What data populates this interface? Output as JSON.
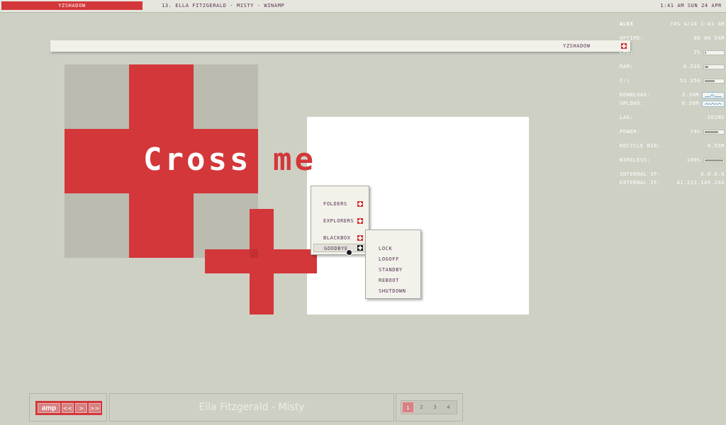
{
  "topbar": {
    "workspace": "YZSHADOW",
    "window_title": "13. ELLA FITZGERALD - MISTY - WINAMP",
    "clock": "1:41 AM SUN 24 APR"
  },
  "slit": {
    "label": "YZSHADOW"
  },
  "wallpaper": {
    "text_white": "Cross",
    "text_red": "me"
  },
  "stats": {
    "user": "ALEX",
    "header_value": "74%  4/24    1:41 AM",
    "rows": [
      {
        "k": "UPTIME:",
        "v": "0D 0H 54M"
      },
      {
        "k": "CPU:",
        "v": "2%",
        "bar": 0.08
      },
      {
        "k": "RAM:",
        "v": "0.52G",
        "bar": 0.2
      },
      {
        "k": "C:\\",
        "v": "51.35G",
        "bar": 0.55
      },
      {
        "k": "DOWNLOAD:",
        "v": "3.34M"
      },
      {
        "k": "UPLOAD:",
        "v": "0.26M"
      },
      {
        "k": "LAG:",
        "v": "261MS"
      },
      {
        "k": "POWER:",
        "v": "74%",
        "bar": 0.74
      },
      {
        "k": "RECYCLE BIN:",
        "v": "0.55M"
      },
      {
        "k": "WIRELESS:",
        "v": "100%",
        "bar": 1.0
      },
      {
        "k": "INTERNAL IP:",
        "v": "0.0.0.0"
      },
      {
        "k": "EXTERNAL IP:",
        "v": "41.212.149.244"
      }
    ]
  },
  "menu": {
    "items": [
      "FOLDERS",
      "EXPLORERS",
      "BLACKBOX",
      "GOODBYE"
    ],
    "submenu": [
      "LOCK",
      "LOGOFF",
      "STANDBY",
      "REBOOT",
      "SHUTDOWN"
    ]
  },
  "player": {
    "logo": "amp",
    "prev": "<<",
    "play": ">",
    "next": ">>"
  },
  "song": "Ella Fitzgerald - Misty",
  "workspaces": [
    "1",
    "2",
    "3",
    "4"
  ],
  "colors": {
    "accent": "#d3373a",
    "background": "#cfd0c4",
    "panel": "#f2f2eb",
    "text": "#5a2f52"
  }
}
